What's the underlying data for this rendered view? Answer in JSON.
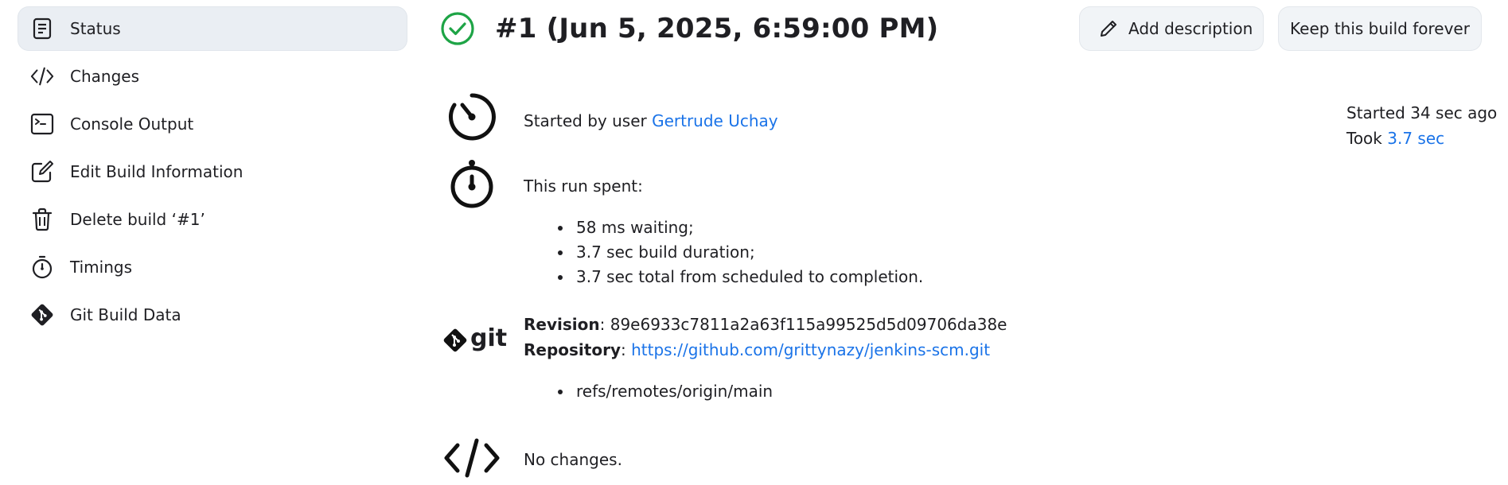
{
  "sidebar": {
    "items": [
      {
        "label": "Status",
        "icon": "document-icon",
        "active": true
      },
      {
        "label": "Changes",
        "icon": "code-icon"
      },
      {
        "label": "Console Output",
        "icon": "terminal-icon"
      },
      {
        "label": "Edit Build Information",
        "icon": "edit-icon"
      },
      {
        "label": "Delete build ‘#1’",
        "icon": "trash-icon"
      },
      {
        "label": "Timings",
        "icon": "stopwatch-icon"
      },
      {
        "label": "Git Build Data",
        "icon": "git-logo-icon"
      }
    ]
  },
  "header": {
    "title": "#1 (Jun 5, 2025, 6:59:00 PM)",
    "status": "success",
    "status_color": "#1ea446",
    "add_description_label": "Add description",
    "keep_forever_label": "Keep this build forever"
  },
  "cause": {
    "prefix": "Started by user ",
    "user": "Gertrude Uchay"
  },
  "timing_summary": {
    "started_label": "Started 34 sec ago",
    "took_prefix": "Took ",
    "took_value": "3.7 sec"
  },
  "run_spent": {
    "heading": "This run spent:",
    "items": [
      "58 ms waiting;",
      "3.7 sec build duration;",
      "3.7 sec total from scheduled to completion."
    ]
  },
  "git": {
    "logo_text": "git",
    "revision_label": "Revision",
    "revision": "89e6933c7811a2a63f115a99525d5d09706da38e",
    "repository_label": "Repository",
    "repository_url": "https://github.com/grittynazy/jenkins-scm.git",
    "refs": [
      "refs/remotes/origin/main"
    ]
  },
  "changes": {
    "text": "No changes."
  },
  "colors": {
    "link": "#1a73e8",
    "success": "#1ea446",
    "active_bg": "#eaeef3"
  }
}
